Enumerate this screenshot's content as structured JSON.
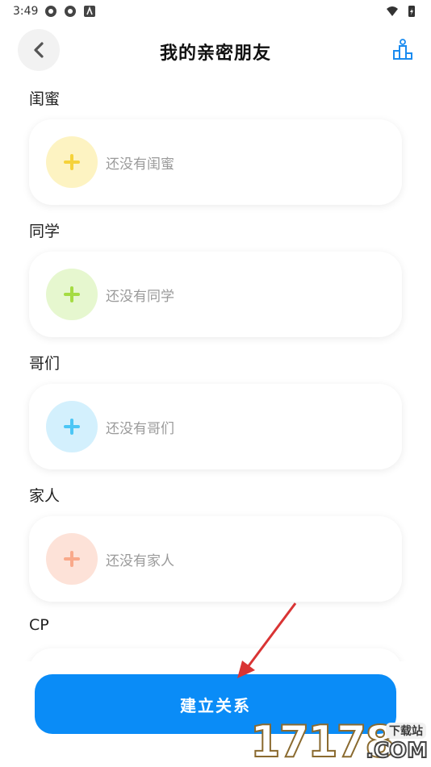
{
  "status_bar": {
    "time": "3:49"
  },
  "header": {
    "title": "我的亲密朋友"
  },
  "sections": [
    {
      "label": "闺蜜",
      "empty_text": "还没有闺蜜",
      "circle_color": "#fdf3c2",
      "plus_color": "#f5d23a"
    },
    {
      "label": "同学",
      "empty_text": "还没有同学",
      "circle_color": "#e6f7cf",
      "plus_color": "#a5dc43"
    },
    {
      "label": "哥们",
      "empty_text": "还没有哥们",
      "circle_color": "#d3f0fd",
      "plus_color": "#4bc6f5"
    },
    {
      "label": "家人",
      "empty_text": "还没有家人",
      "circle_color": "#fde2d8",
      "plus_color": "#f9a98a"
    },
    {
      "label": "CP"
    }
  ],
  "footer": {
    "primary_button": "建立关系"
  },
  "watermark": {
    "number": "17178",
    "side_text": "下载站",
    "suffix": ".COM"
  },
  "colors": {
    "accent": "#0a8cf7",
    "annotation_arrow": "#d93434"
  }
}
